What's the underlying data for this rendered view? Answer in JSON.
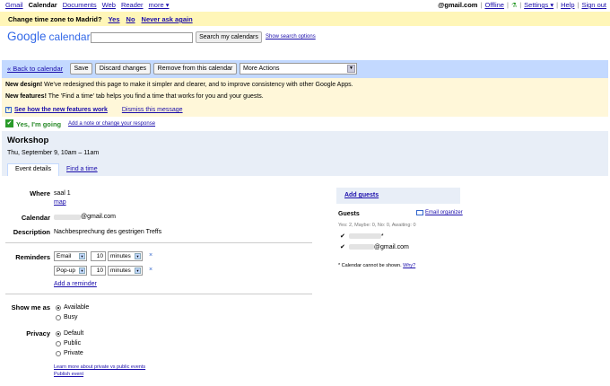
{
  "topnav": {
    "items": [
      "Gmail",
      "Calendar",
      "Documents",
      "Web",
      "Reader",
      "more ▾"
    ],
    "current": "Calendar",
    "account": "@gmail.com",
    "offline": "Offline",
    "settings": "Settings ▾",
    "help": "Help",
    "signout": "Sign out"
  },
  "tz_banner": {
    "question": "Change time zone to Madrid?",
    "yes": "Yes",
    "no": "No",
    "never": "Never ask again"
  },
  "header": {
    "logo_word": "Google",
    "product": "calendar",
    "search_placeholder": "",
    "search_button": "Search my calendars",
    "search_options": "Show search options"
  },
  "actions": {
    "back": "« Back to calendar",
    "save": "Save",
    "discard": "Discard changes",
    "remove": "Remove from this calendar",
    "more": "More Actions"
  },
  "news": {
    "l1_bold": "New design!",
    "l1_text": " We've redesigned this page to make it simpler and clearer, and to improve consistency with other Google Apps.",
    "l2_bold": "New features!",
    "l2_text": " The 'Find a time' tab helps you find a time that works for you and your guests.",
    "see_how": "See how the new features work",
    "dismiss": "Dismiss this message"
  },
  "rsvp": {
    "status": "Yes, I'm going",
    "note_link": "Add a note or change your response"
  },
  "event": {
    "title": "Workshop",
    "date": "Thu, September 9, 10am – 11am",
    "tabs": [
      "Event details",
      "Find a time"
    ]
  },
  "form": {
    "where_label": "Where",
    "where_value": "saal 1",
    "map_link": "map",
    "calendar_label": "Calendar",
    "calendar_value": "@gmail.com",
    "description_label": "Description",
    "description_value": "Nachbesprechung des gestrigen Treffs",
    "reminders_label": "Reminders",
    "reminders": [
      {
        "type": "Email",
        "amount": "10",
        "unit": "minutes"
      },
      {
        "type": "Pop-up",
        "amount": "10",
        "unit": "minutes"
      }
    ],
    "remove_x": "×",
    "add_reminder": "Add a reminder",
    "showme_label": "Show me as",
    "showme_options": [
      "Available",
      "Busy"
    ],
    "showme_selected": 0,
    "privacy_label": "Privacy",
    "privacy_options": [
      "Default",
      "Public",
      "Private"
    ],
    "privacy_selected": 0,
    "learn_more": "Learn more about private vs public events",
    "publish": "Publish event"
  },
  "guests": {
    "add_guests": "Add guests",
    "label": "Guests",
    "email_organizer": "Email organizer",
    "summary": "Yes: 2, Maybe: 0, No: 0, Awaiting: 0",
    "list": [
      {
        "suffix": "*"
      },
      {
        "suffix": "@gmail.com"
      }
    ],
    "cal_note": "* Calendar cannot be shown.",
    "why": "Why?"
  }
}
